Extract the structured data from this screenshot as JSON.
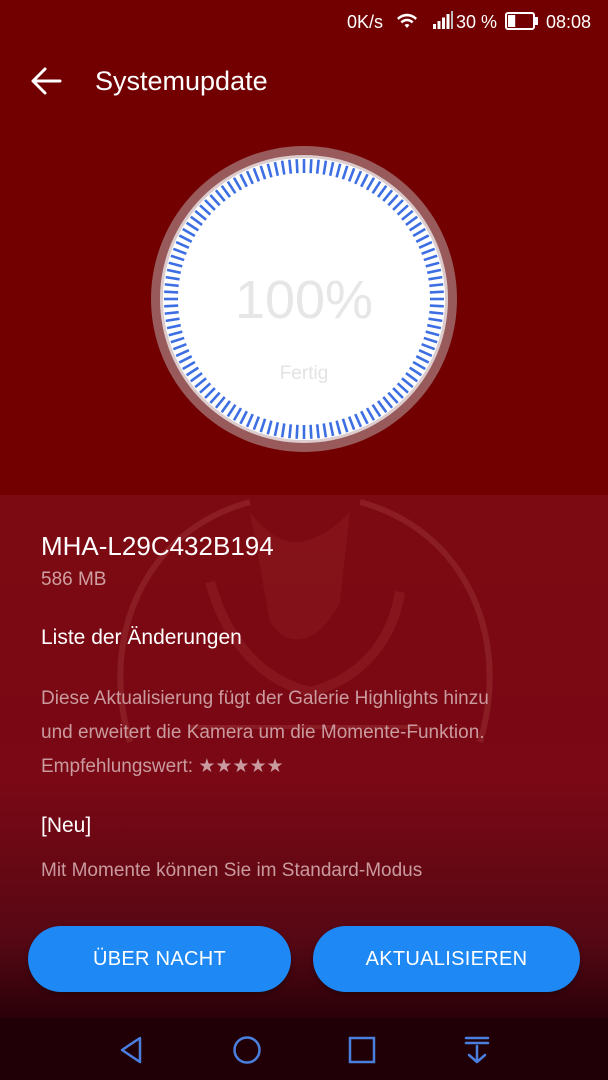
{
  "status_bar": {
    "speed": "0K/s",
    "battery_percent": "30 %",
    "battery_level": 0.3,
    "time": "08:08",
    "icons": [
      "wifi-icon",
      "signal-icon",
      "battery-icon"
    ]
  },
  "header": {
    "back_icon": "arrow-left-icon",
    "title": "Systemupdate"
  },
  "progress": {
    "percent_text": "100%",
    "value": 1.0,
    "status": "Fertig"
  },
  "update": {
    "version": "MHA-L29C432B194",
    "size": "586 MB",
    "changes_title": "Liste der Änderungen",
    "changes_line1": "Diese Aktualisierung fügt der Galerie Highlights hinzu",
    "changes_line2": "und erweitert die Kamera um die Momente-Funktion.",
    "changes_line3": "Empfehlungswert: ★★★★★",
    "new_title": "[Neu]",
    "new_line1": "Mit Momente können Sie im Standard-Modus"
  },
  "buttons": {
    "overnight": "ÜBER NACHT",
    "update": "AKTUALISIEREN"
  },
  "nav": {
    "icons": [
      "nav-back-icon",
      "nav-home-icon",
      "nav-recents-icon",
      "nav-notification-icon"
    ]
  },
  "colors": {
    "header_bg": "#720000",
    "button_bg": "#1e88f4",
    "ring_blue": "#3d6fe3"
  }
}
